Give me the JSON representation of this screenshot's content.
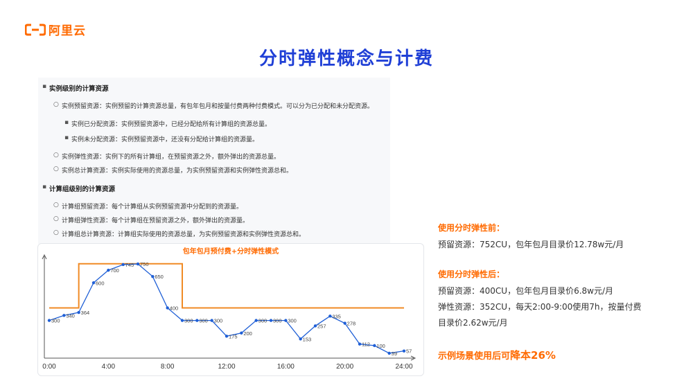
{
  "brand": {
    "name": "阿里云",
    "color": "#ff6a00"
  },
  "title": "分时弹性概念与计费",
  "doc": {
    "sections": [
      {
        "heading": "实例级别的计算资源",
        "items": [
          {
            "text": "实例预留资源：实例预留的计算资源总量，有包年包月和按量付费两种付费模式。可以分为已分配和未分配资源。",
            "subitems": [
              "实例已分配资源：实例预留资源中，已经分配给所有计算组的资源总量。",
              "实例未分配资源：实例预留资源中，还没有分配给计算组的资源量。"
            ]
          },
          {
            "text": "实例弹性资源：实例下的所有计算组，在预留资源之外，额外弹出的资源总量。",
            "subitems": []
          },
          {
            "text": "实例总计算资源：实例实际使用的资源总量，为实例预留资源和实例弹性资源总和。",
            "subitems": []
          }
        ]
      },
      {
        "heading": "计算组级别的计算资源",
        "items": [
          {
            "text": "计算组预留资源：每个计算组从实例预留资源中分配到的资源量。",
            "subitems": []
          },
          {
            "text": "计算组弹性资源：每个计算组在预留资源之外，额外弹出的资源量。",
            "subitems": []
          },
          {
            "text": "计算组总计算资源：计算组实际使用的资源总量，为实例预留资源和实例弹性资源总和。",
            "subitems": []
          }
        ]
      }
    ]
  },
  "chart_data": {
    "type": "line",
    "title": "包年包月预付费+分时弹性模式",
    "x_ticks": [
      "0:00",
      "4:00",
      "8:00",
      "12:00",
      "16:00",
      "20:00",
      "24:00"
    ],
    "xlim": [
      0,
      24
    ],
    "ylim": [
      0,
      800
    ],
    "series": [
      {
        "color": "#1f5fd6",
        "x": [
          0,
          1,
          2,
          3,
          4,
          5,
          6,
          7,
          8,
          9,
          10,
          11,
          12,
          13,
          14,
          15,
          16,
          17,
          18,
          19,
          20,
          21,
          22,
          23,
          24
        ],
        "values": [
          300,
          340,
          364,
          600,
          700,
          745,
          750,
          650,
          400,
          300,
          300,
          300,
          175,
          200,
          300,
          300,
          300,
          153,
          257,
          335,
          278,
          112,
          100,
          39,
          57
        ],
        "labels": [
          "300",
          "340",
          "364",
          "600",
          "700",
          "745",
          "750",
          "650",
          "400",
          "300",
          "300",
          "300",
          "175",
          "200",
          "300",
          "300",
          "300",
          "153",
          "257",
          "335",
          "278",
          "112",
          "100",
          "39",
          "57"
        ]
      },
      {
        "color": "#f08a24",
        "x": [
          0,
          2,
          2,
          9,
          9,
          24
        ],
        "values": [
          400,
          400,
          752,
          752,
          400,
          400
        ]
      }
    ]
  },
  "info": {
    "before_title": "使用分时弹性前：",
    "before_line": "预留资源：752CU，包年包月目录价12.78w元/月",
    "after_title": "使用分时弹性后：",
    "after_line1": "预留资源：400CU，包年包月目录价6.8w元/月",
    "after_line2": "弹性资源：352CU，每天2:00-9:00使用7h，按量付费",
    "after_line3": "目录价2.62w元/月",
    "result_prefix": "示例场景使用后可",
    "result_emph": "降本26%"
  }
}
